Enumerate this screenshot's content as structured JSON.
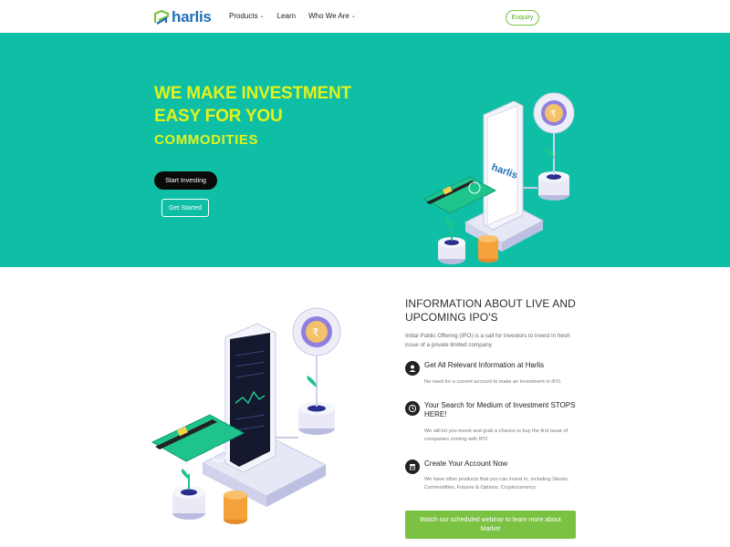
{
  "nav": {
    "logo_text": "harlis",
    "menu": [
      {
        "label": "Products",
        "has_dropdown": true
      },
      {
        "label": "Learn",
        "has_dropdown": false
      },
      {
        "label": "Who We Are",
        "has_dropdown": true
      }
    ],
    "enquiry_label": "Enquiry"
  },
  "hero": {
    "title_line1": "WE MAKE INVESTMENT",
    "title_line2": "EASY FOR YOU",
    "subtitle": "COMMODITIES",
    "start_button": "Start Investing",
    "get_started_button": "Get Started",
    "bg_color": "#0ebfa6",
    "accent_color": "#e4f21a",
    "phone_logo": "harlis"
  },
  "info": {
    "title_line1": "INFORMATION ABOUT LIVE AND",
    "title_line2": "UPCOMING IPO'S",
    "intro": "Initial Public Offering (IPO) is a call for investors to invest in fresh issue of a private limited company.",
    "features": [
      {
        "icon": "user-icon",
        "title": "Get All Relevant Information at Harlis",
        "desc": "No need for a current account to make an investment in IPO."
      },
      {
        "icon": "clock-icon",
        "title": "Your Search for Medium of Investment STOPS HERE!",
        "desc": "We will let you invest and grab a chance to buy the first issue of companies coming with IPO"
      },
      {
        "icon": "shop-icon",
        "title": "Create Your Account Now",
        "desc": "We have other products that you can invest in, including Stocks, Commodities, Futures & Options, Cryptocurrency."
      }
    ],
    "cta_label": "Watch our scheduled webinar to learn more about Market",
    "cta_color": "#7cc242"
  }
}
